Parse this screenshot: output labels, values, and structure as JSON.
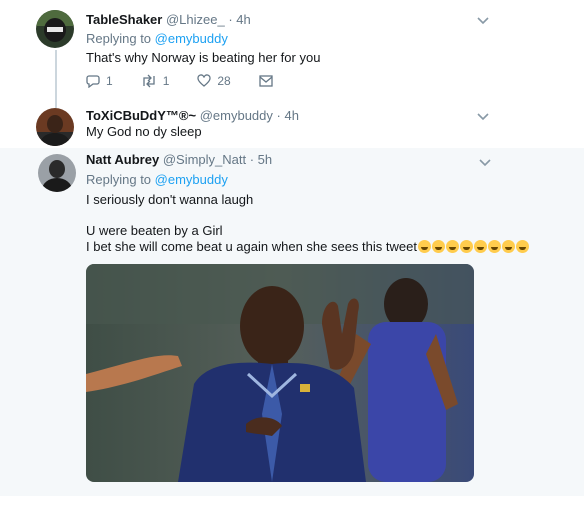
{
  "tweets": [
    {
      "name": "TableShaker",
      "handle": "@Lhizee_",
      "time": "· 4h",
      "replying_prefix": "Replying to",
      "replying_to": "@emybuddy",
      "text": "That's why Norway is beating her for you",
      "replies": "1",
      "retweets": "1",
      "likes": "28"
    },
    {
      "name": "ToXiCBuDdY™®~",
      "handle": "@emybuddy",
      "time": "· 4h",
      "text": "My God no dy sleep"
    },
    {
      "name": "Natt Aubrey",
      "handle": "@Simply_Natt",
      "time": "· 5h",
      "replying_prefix": "Replying to",
      "replying_to": "@emybuddy",
      "text_line1": "I seriously don't wanna laugh",
      "text_line2": "U were beaten by a Girl",
      "text_line3": "I bet she will come beat u again when she sees this tweet"
    }
  ],
  "icons": {
    "reply": "reply-icon",
    "retweet": "retweet-icon",
    "like": "heart-icon",
    "dm": "envelope-icon",
    "more": "chevron-down-icon"
  },
  "colors": {
    "link": "#1da1f2",
    "muted": "#657786",
    "text": "#14171a"
  }
}
